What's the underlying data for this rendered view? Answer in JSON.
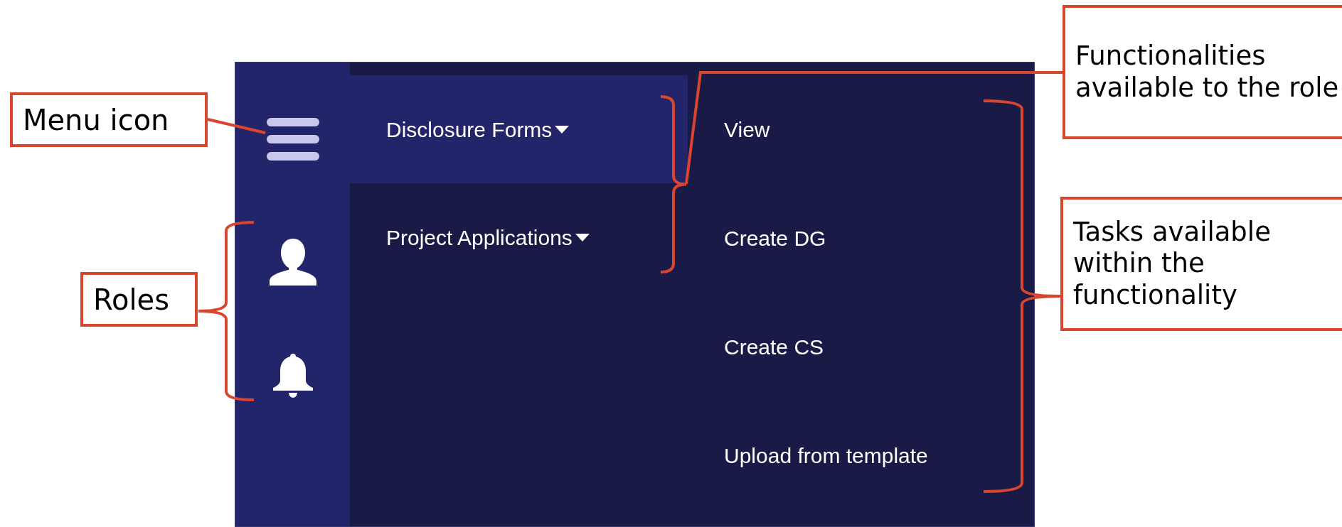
{
  "sidebar": {
    "icons": [
      {
        "kind": "menu"
      },
      {
        "kind": "user"
      },
      {
        "kind": "bell"
      }
    ]
  },
  "functionalities": [
    {
      "label": "Disclosure Forms",
      "selected": true
    },
    {
      "label": "Project Applications",
      "selected": false
    }
  ],
  "tasks": [
    {
      "label": "View"
    },
    {
      "label": "Create DG"
    },
    {
      "label": "Create CS"
    },
    {
      "label": "Upload from template"
    }
  ],
  "annotations": [
    {
      "kind": "menu",
      "text": "Menu icon"
    },
    {
      "kind": "roles",
      "text": "Roles"
    },
    {
      "kind": "functionalities",
      "text": "Functionalities available to the role"
    },
    {
      "kind": "tasks",
      "text": "Tasks available within the functionality"
    }
  ]
}
